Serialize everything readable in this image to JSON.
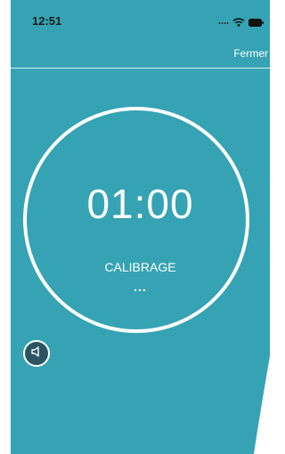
{
  "status_bar": {
    "time": "12:51",
    "signal_icon": "signal-dots-icon",
    "wifi_icon": "wifi-icon",
    "battery_icon": "battery-icon"
  },
  "header": {
    "close_label": "Fermer"
  },
  "timer": {
    "value": "01:00",
    "label": "CALIBRAGE",
    "dots": "..."
  },
  "controls": {
    "sound_icon": "speaker-icon"
  },
  "colors": {
    "background": "#35a3b3",
    "text": "#ffffff",
    "sound_button": "#2b5563"
  }
}
